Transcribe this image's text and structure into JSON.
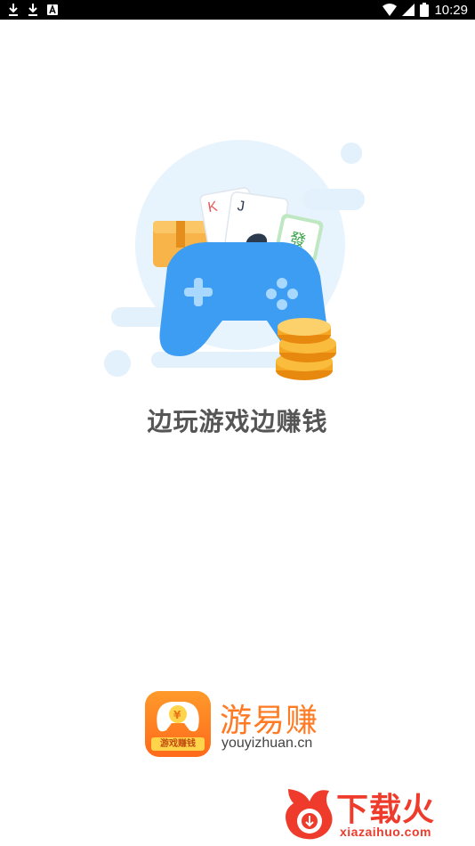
{
  "status_bar": {
    "time": "10:29",
    "battery_level": "80",
    "icons_left": [
      "download-icon",
      "download-icon",
      "notification-a-icon"
    ],
    "icons_right": [
      "wifi-icon",
      "signal-icon",
      "battery-icon"
    ]
  },
  "splash": {
    "slogan": "边玩游戏边赚钱",
    "illustration": [
      "gamepad",
      "playing-cards",
      "mahjong-tile",
      "gold-coins",
      "wallet"
    ]
  },
  "brand": {
    "icon_tag": "游戏赚钱",
    "icon_symbol": "¥",
    "name": "游易赚",
    "domain": "youyizhuan.cn"
  },
  "watermark": {
    "title": "下载火",
    "domain": "xiazaihuo.com"
  },
  "colors": {
    "status_bar": "#000000",
    "gamepad": "#3d9df3",
    "brand_orange": "#ff7a22",
    "watermark_red": "#ef3b2c",
    "coin_gold": "#f7a21b"
  }
}
